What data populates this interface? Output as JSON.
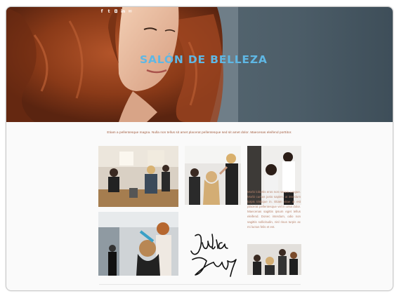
{
  "hero": {
    "title": "SALÓN DE BELLEZA",
    "social_icons": [
      "facebook-icon",
      "twitter-icon",
      "instagram-icon",
      "linkedin-icon",
      "email-icon"
    ]
  },
  "intro": {
    "text": "Etiam a pellentesque magna. Nulla non tellus sit amet placerat pellentesque sed sit amet dolor. Maecenas eleifend porttitor."
  },
  "gallery": {
    "side_text": "Morbi lobortis eros non rutrum congue. Morbi cursus justo sapien, ut interdum turpis tristique in. Etiam vitae at est placerat pellentesque vel in urna dolor. Maecenas sagittis ipsum eget tellus eleifend. Donec interdum, odio non sagittis sollicitudin, nisl risus turpis ac mi luctus felis et est."
  },
  "signature": {
    "line1": "Julia",
    "line2": "Alvez"
  },
  "colors": {
    "title": "#5fb7e4",
    "body_text": "#a05a3c",
    "side_text": "#b9856e"
  }
}
